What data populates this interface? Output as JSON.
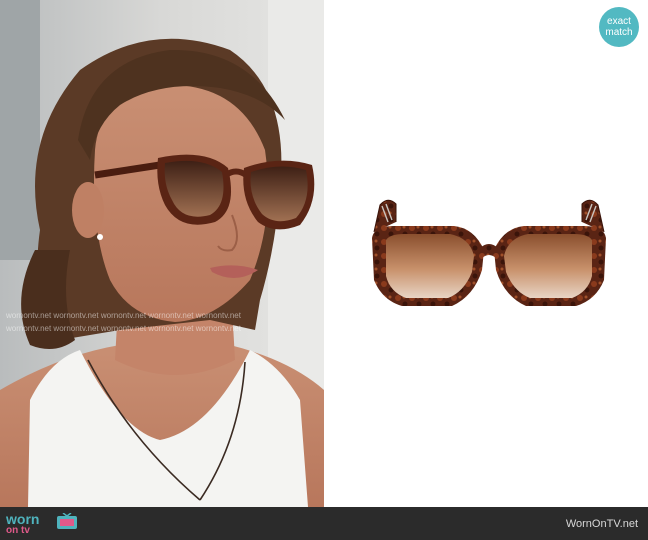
{
  "badge": {
    "line1": "exact",
    "line2": "match"
  },
  "footer": {
    "logo_top": "worn",
    "logo_bottom": "on tv",
    "site_url": "WornOnTV.net"
  },
  "watermark_text": "wornontv.net",
  "colors": {
    "badge": "#52b9c2",
    "footer_bg": "#2b2b2b",
    "logo_teal": "#4fb3bd",
    "logo_pink": "#e05a8a",
    "tortoise": "#5a2414",
    "lens": "#b07a50"
  },
  "images": {
    "left": "photo of woman with shoulder-length brown hair wearing oversized tortoiseshell sunglasses and white tank top",
    "right": "product photo of oversized tortoiseshell sunglasses with gradient brown lenses and chain-detail temples"
  }
}
